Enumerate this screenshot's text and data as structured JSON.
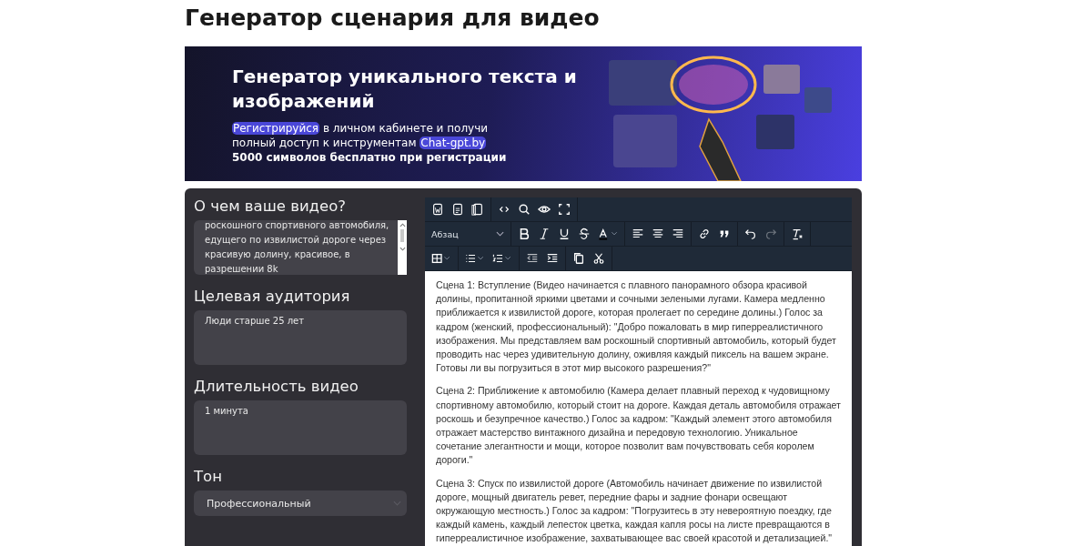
{
  "page_title": "Генератор сценария для видео",
  "banner": {
    "heading": "Генератор уникального текста и изображений",
    "lines": [
      [
        {
          "text": "Регистрируйся",
          "highlight": true
        },
        {
          "text": " в личном кабинете и получи",
          "highlight": false
        }
      ],
      [
        {
          "text": "полный доступ к инструментам ",
          "highlight": false
        },
        {
          "text": "Chat-gpt.by",
          "highlight": true
        }
      ]
    ],
    "note": "5000 символов бесплатно при регистрации"
  },
  "form": {
    "fields": [
      {
        "kind": "textarea",
        "label": "О чем ваше видео?",
        "value": "роскошного спортивного автомобиля, едущего по извилистой дороге через красивую долину, красивое, в разрешении 8k",
        "scrolled": true
      },
      {
        "kind": "textarea",
        "label": "Целевая аудитория",
        "value": "Люди старше 25 лет",
        "scrolled": false
      },
      {
        "kind": "textarea",
        "label": "Длительность видео",
        "value": "1 минута",
        "scrolled": false
      },
      {
        "kind": "select",
        "label": "Тон",
        "value": "Профессиональный"
      }
    ]
  },
  "editor": {
    "block_format": "Абзац",
    "redo_disabled": true,
    "paragraphs": [
      "Сцена 1: Вступление (Видео начинается с плавного панорамного обзора красивой долины, пропитанной яркими цветами и сочными зелеными лугами. Камера медленно приближается к извилистой дороге, которая пролегает по середине долины.) Голос за кадром (женский, профессиональный): \"Добро пожаловать в мир гиперреалистичного изображения. Мы представляем вам роскошный спортивный автомобиль, который будет проводить нас через удивительную долину, оживляя каждый пиксель на вашем экране. Готовы ли вы погрузиться в этот мир высокого разрешения?\"",
      "Сцена 2: Приближение к автомобилю (Камера делает плавный переход к чудовищному спортивному автомобилю, который стоит на дороге. Каждая деталь автомобиля отражает роскошь и безупречное качество.) Голос за кадром: \"Каждый элемент этого автомобиля отражает мастерство винтажного дизайна и передовую технологию. Уникальное сочетание элегантности и мощи, которое позволит вам почувствовать себя королем дороги.\"",
      "Сцена 3: Спуск по извилистой дороге (Автомобиль начинает движение по извилистой дороге, мощный двигатель ревет, передние фары и задние фонари освещают окружающую местность.) Голос за кадром: \"Погрузитесь в эту невероятную поездку, где каждый камень, каждый лепесток цветка, каждая капля росы на листе превращаются в гиперреалистичное изображение, захватывающее вас своей красотой и детализацией.\""
    ]
  }
}
